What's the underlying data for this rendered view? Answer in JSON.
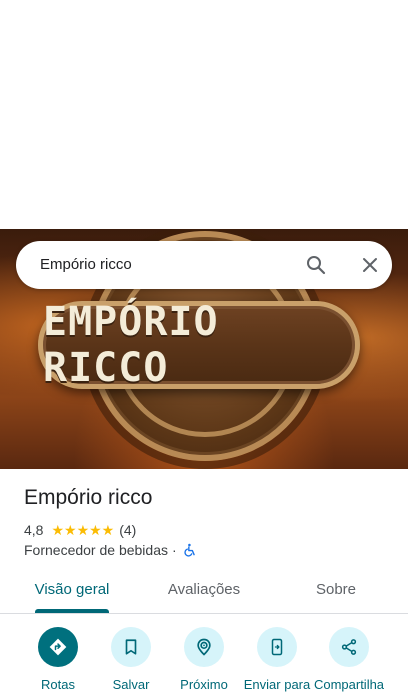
{
  "search": {
    "query": "Empório ricco"
  },
  "hero": {
    "sign_text": "EMPÓRIO RICCO"
  },
  "place": {
    "name": "Empório ricco",
    "rating": "4,8",
    "stars": "★★★★★",
    "review_count": "(4)",
    "category": "Fornecedor de bebidas",
    "separator": "·",
    "accessibility_icon": "wheelchair-icon"
  },
  "tabs": [
    {
      "label": "Visão geral",
      "active": true
    },
    {
      "label": "Avaliações",
      "active": false
    },
    {
      "label": "Sobre",
      "active": false
    }
  ],
  "actions": [
    {
      "label": "Rotas",
      "icon": "directions-icon"
    },
    {
      "label": "Salvar",
      "icon": "bookmark-icon"
    },
    {
      "label": "Próximo",
      "icon": "nearby-icon"
    },
    {
      "label": "Enviar para",
      "icon": "send-to-phone-icon"
    },
    {
      "label": "Compartilha",
      "icon": "share-icon"
    }
  ],
  "colors": {
    "accent": "#006877",
    "primary_button": "#00707e",
    "secondary_button": "#d6f4fa",
    "star": "#fbbc04"
  }
}
